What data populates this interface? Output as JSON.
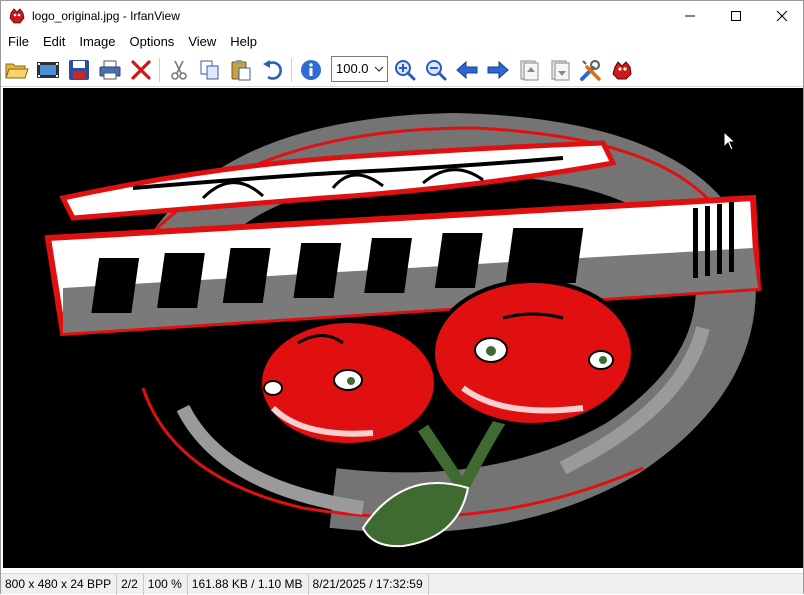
{
  "window": {
    "title": "logo_original.jpg - IrfanView",
    "minimize_icon": "minimize-icon",
    "maximize_icon": "maximize-icon",
    "close_icon": "close-icon"
  },
  "menu": [
    "File",
    "Edit",
    "Image",
    "Options",
    "View",
    "Help"
  ],
  "toolbar": {
    "buttons": [
      {
        "name": "open-icon"
      },
      {
        "name": "slideshow-icon"
      },
      {
        "name": "save-icon"
      },
      {
        "name": "print-icon"
      },
      {
        "name": "delete-icon"
      },
      {
        "name": "cut-icon"
      },
      {
        "name": "copy-icon"
      },
      {
        "name": "paste-icon"
      },
      {
        "name": "undo-icon"
      },
      {
        "name": "info-icon"
      },
      {
        "name": "zoom-in-icon"
      },
      {
        "name": "zoom-out-icon"
      },
      {
        "name": "previous-icon"
      },
      {
        "name": "next-icon"
      },
      {
        "name": "first-file-icon"
      },
      {
        "name": "last-file-icon"
      },
      {
        "name": "properties-icon"
      },
      {
        "name": "irfanview-icon"
      }
    ],
    "zoom_value": "100.0"
  },
  "status": {
    "dimensions": "800 x 480 x 24 BPP",
    "index": "2/2",
    "zoom": "100 %",
    "size": "161.88 KB / 1.10 MB",
    "datetime": "8/21/2025 / 17:32:59"
  },
  "colors": {
    "canvas_bg": "#000000",
    "logo_red": "#e01010",
    "logo_gray": "#7a7a7a",
    "leaf_green": "#3f6b30"
  }
}
